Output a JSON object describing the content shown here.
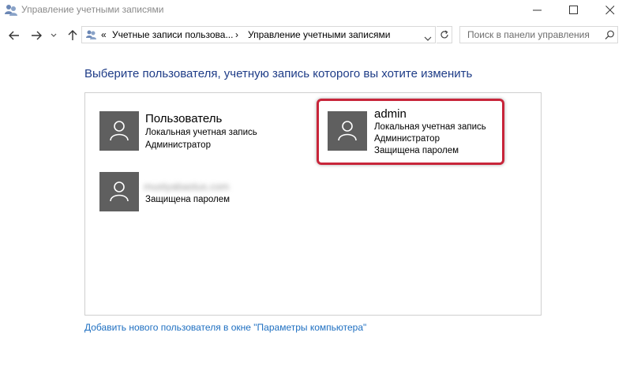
{
  "window": {
    "title": "Управление учетными записями",
    "icon": "users-icon"
  },
  "address": {
    "overflow": "«",
    "crumbs": [
      "Учетные записи пользова...",
      "Управление учетными записями"
    ]
  },
  "search": {
    "placeholder": "Поиск в панели управления"
  },
  "main": {
    "heading": "Выберите пользователя, учетную запись которого вы хотите изменить",
    "accounts": [
      {
        "name": "Пользователь",
        "lines": [
          "Локальная учетная запись",
          "Администратор"
        ]
      },
      {
        "name": "admin",
        "lines": [
          "Локальная учетная запись",
          "Администратор",
          "Защищена паролем"
        ],
        "highlight_color": "#c8253a"
      },
      {
        "name": "mustyabastus.com",
        "lines": [
          "Защищена паролем"
        ],
        "name_blurred": true
      }
    ],
    "add_user_link": "Добавить нового пользователя в окне \"Параметры компьютера\""
  },
  "colors": {
    "heading": "#1e3c87",
    "link": "#1e6fc1",
    "avatar_bg": "#5f5f5f"
  }
}
